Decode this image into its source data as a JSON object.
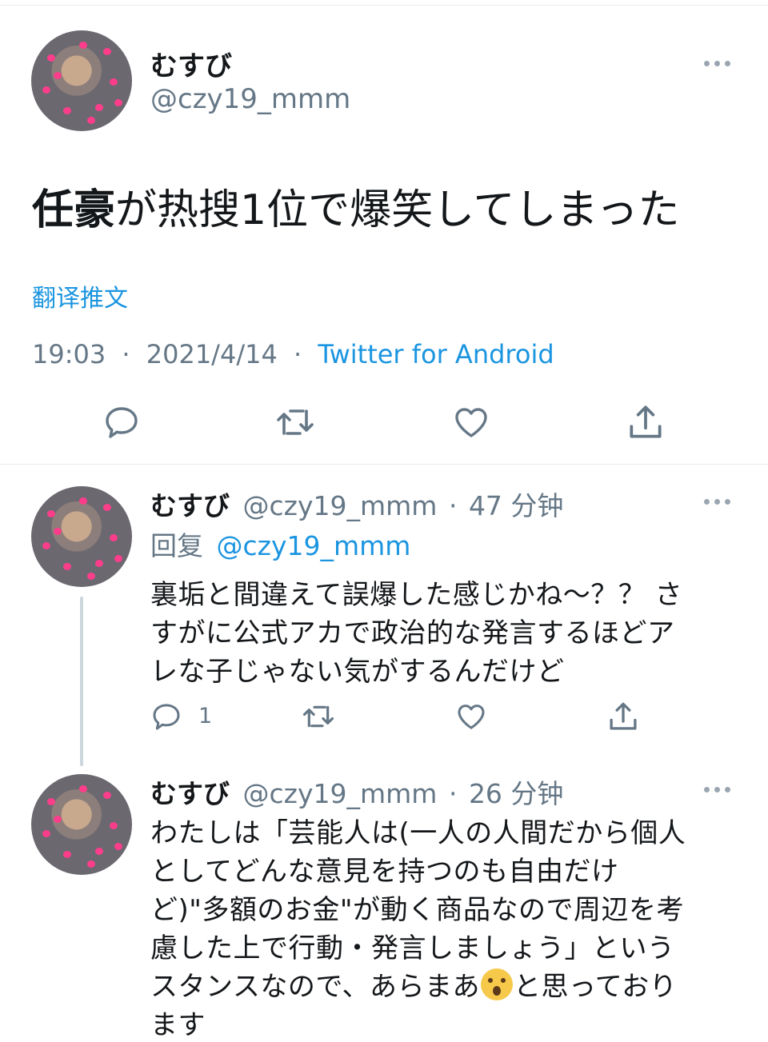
{
  "main_tweet": {
    "display_name": "むすび",
    "handle": "@czy19_mmm",
    "text_bold": "任豪",
    "text_rest": "が热搜1位で爆笑してしまった",
    "translate_label": "翻译推文",
    "time": "19:03",
    "sep1": "·",
    "date": "2021/4/14",
    "sep2": "·",
    "source": "Twitter for Android"
  },
  "reply_1": {
    "display_name": "むすび",
    "handle": "@czy19_mmm",
    "sep": "·",
    "age": "47 分钟",
    "reply_label": "回复",
    "reply_to": "@czy19_mmm",
    "lines": [
      "裏垢と間違えて誤爆した感じかね～？？ さ",
      "すがに公式アカで政治的な発言するほどア",
      "レな子じゃない気がするんだけど"
    ],
    "reply_count": "1"
  },
  "reply_2": {
    "display_name": "むすび",
    "handle": "@czy19_mmm",
    "sep": "·",
    "age": "26 分钟",
    "lines": [
      "わたしは「芸能人は(一人の人間だから個人",
      "としてどんな意見を持つのも自由だけ",
      "ど)\"多額のお金\"が動く商品なので周辺を考",
      "慮した上で行動・発言しましょう」という"
    ],
    "line5_before": "スタンスなので、あらまあ",
    "line5_after": "と思っており",
    "line6": "ます",
    "emoji_icon": "hushed-face-emoji"
  },
  "colors": {
    "link_blue": "#1b95e0",
    "secondary_gray": "#657786",
    "icon_gray": "#657786",
    "divider": "#e6ecf0"
  }
}
